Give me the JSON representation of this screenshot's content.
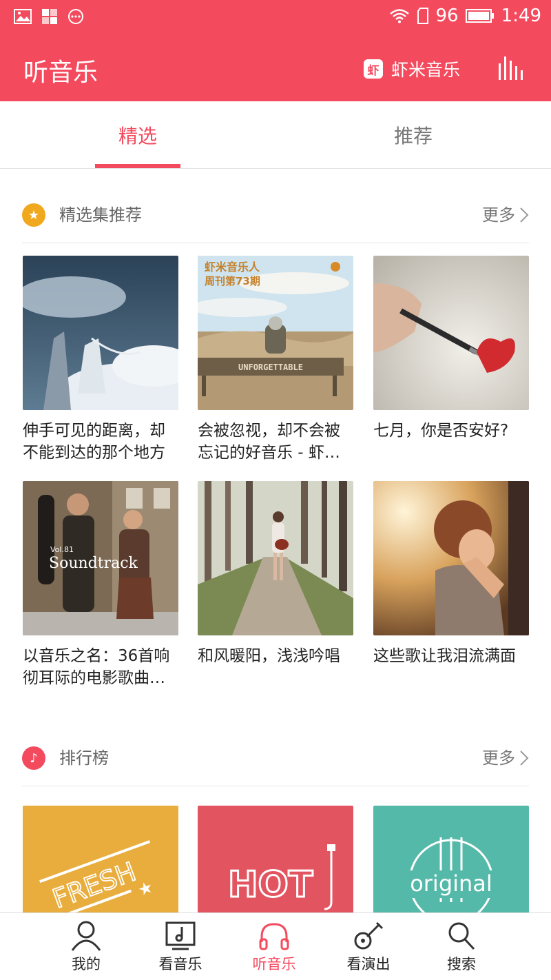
{
  "status_bar": {
    "battery": "96",
    "time": "1:49"
  },
  "header": {
    "title": "听音乐",
    "brand_badge": "虾",
    "brand_name": "虾米音乐"
  },
  "tabs": [
    {
      "label": "精选",
      "active": true
    },
    {
      "label": "推荐",
      "active": false
    }
  ],
  "section_featured": {
    "title": "精选集推荐",
    "more": "更多",
    "items": [
      {
        "caption": "伸手可见的距离，却不能到达的那个地方"
      },
      {
        "caption": "会被忽视，却不会被忘记的好音乐 - 虾…",
        "cover_title": "虾米音乐人",
        "cover_subtitle": "周刊第73期",
        "cover_bench": "UNFORGETTABLE"
      },
      {
        "caption": "七月，你是否安好?"
      },
      {
        "caption": "以音乐之名：36首响彻耳际的电影歌曲…",
        "cover_vol": "Vol.81",
        "cover_title": "Soundtrack"
      },
      {
        "caption": "和风暖阳，浅浅吟唱"
      },
      {
        "caption": "这些歌让我泪流满面"
      }
    ]
  },
  "section_charts": {
    "title": "排行榜",
    "more": "更多",
    "items": [
      {
        "cover_text": "FRESH",
        "color": "#e8ad3c"
      },
      {
        "cover_text": "HOT",
        "color": "#e2545f"
      },
      {
        "cover_text": "original",
        "color": "#55b9a9"
      }
    ]
  },
  "bottom_nav": [
    {
      "label": "我的",
      "icon": "person-icon",
      "active": false
    },
    {
      "label": "看音乐",
      "icon": "music-monitor-icon",
      "active": false
    },
    {
      "label": "听音乐",
      "icon": "headphones-icon",
      "active": true
    },
    {
      "label": "看演出",
      "icon": "guitar-icon",
      "active": false
    },
    {
      "label": "搜索",
      "icon": "search-icon",
      "active": false
    }
  ],
  "colors": {
    "accent": "#f44a5e",
    "featured_icon": "#f0a81e",
    "charts_icon": "#f44a5e"
  }
}
